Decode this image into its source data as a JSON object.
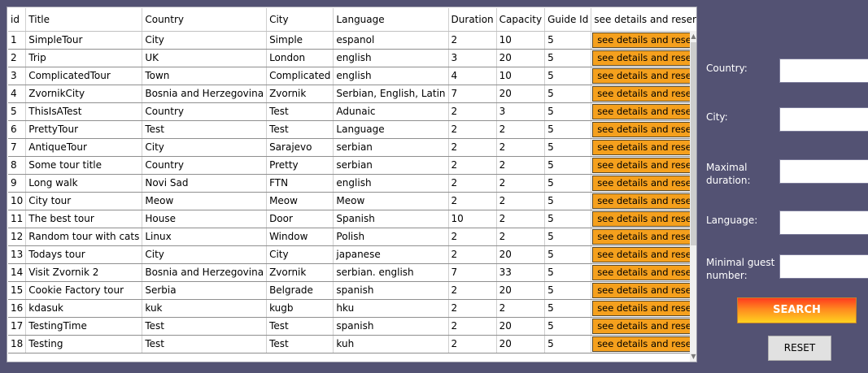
{
  "table": {
    "columns": [
      "id",
      "Title",
      "Country",
      "City",
      "Language",
      "Duration",
      "Capacity",
      "Guide Id",
      "see details and reserve"
    ],
    "button_label": "see details and reserve",
    "rows": [
      [
        "1",
        "SimpleTour",
        "City",
        "Simple",
        "espanol",
        "2",
        "10",
        "5"
      ],
      [
        "2",
        "Trip",
        "UK",
        "London",
        "english",
        "3",
        "20",
        "5"
      ],
      [
        "3",
        "ComplicatedTour",
        "Town",
        "Complicated",
        "english",
        "4",
        "10",
        "5"
      ],
      [
        "4",
        "ZvornikCity",
        "Bosnia and Herzegovina",
        "Zvornik",
        "Serbian, English, Latin",
        "7",
        "20",
        "5"
      ],
      [
        "5",
        "ThisIsATest",
        "Country",
        "Test",
        "Adunaic",
        "2",
        "3",
        "5"
      ],
      [
        "6",
        "PrettyTour",
        "Test",
        "Test",
        "Language",
        "2",
        "2",
        "5"
      ],
      [
        "7",
        "AntiqueTour",
        "City",
        "Sarajevo",
        "serbian",
        "2",
        "2",
        "5"
      ],
      [
        "8",
        "Some tour title",
        "Country",
        "Pretty",
        "serbian",
        "2",
        "2",
        "5"
      ],
      [
        "9",
        "Long walk",
        "Novi Sad",
        "FTN",
        "english",
        "2",
        "2",
        "5"
      ],
      [
        "10",
        "City tour",
        "Meow",
        "Meow",
        "Meow",
        "2",
        "2",
        "5"
      ],
      [
        "11",
        "The best tour",
        "House",
        "Door",
        "Spanish",
        "10",
        "2",
        "5"
      ],
      [
        "12",
        "Random tour with cats",
        "Linux",
        "Window",
        "Polish",
        "2",
        "2",
        "5"
      ],
      [
        "13",
        "Todays tour",
        "City",
        "City",
        "japanese",
        "2",
        "20",
        "5"
      ],
      [
        "14",
        "Visit Zvornik 2",
        "Bosnia and Herzegovina",
        "Zvornik",
        "serbian. english",
        "7",
        "33",
        "5"
      ],
      [
        "15",
        "Cookie Factory tour",
        "Serbia",
        "Belgrade",
        "spanish",
        "2",
        "20",
        "5"
      ],
      [
        "16",
        "kdasuk",
        "kuk",
        "kugb",
        "hku",
        "2",
        "2",
        "5"
      ],
      [
        "17",
        "TestingTime",
        "Test",
        "Test",
        "spanish",
        "2",
        "20",
        "5"
      ],
      [
        "18",
        "Testing",
        "Test",
        "Test",
        "kuh",
        "2",
        "20",
        "5"
      ]
    ]
  },
  "filters": {
    "country_label": "Country:",
    "city_label": "City:",
    "max_duration_label_1": "Maximal",
    "max_duration_label_2": "duration:",
    "language_label": "Language:",
    "min_guests_label_1": "Minimal guest",
    "min_guests_label_2": "number:",
    "country_value": "",
    "city_value": "",
    "duration_value": "",
    "language_value": "",
    "guests_value": ""
  },
  "buttons": {
    "search_label": "SEARCH",
    "reset_label": "RESET"
  },
  "colors": {
    "background": "#535273",
    "reserve_button": "#f5a01d"
  }
}
